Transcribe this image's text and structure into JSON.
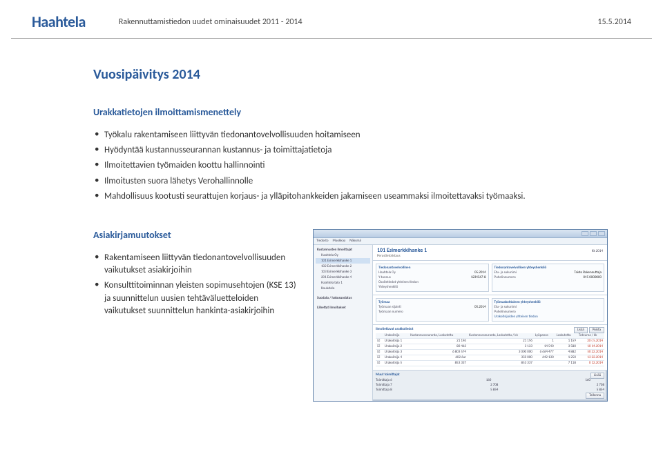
{
  "header": {
    "logo": "Haahtela",
    "title": "Rakennuttamistiedon uudet ominaisuudet 2011 - 2014",
    "date": "15.5.2014"
  },
  "main_heading": "Vuosipäivitys 2014",
  "section_declare": {
    "heading": "Urakkatietojen ilmoittamismenettely",
    "items": [
      "Työkalu rakentamiseen liittyvän tiedonantovelvollisuuden hoitamiseen",
      "Hyödyntää kustannusseurannan kustannus- ja toimittajatietoja",
      "Ilmoitettavien työmaiden koottu hallinnointi",
      "Ilmoitusten suora lähetys Verohallinnolle",
      "Mahdollisuus kootusti seurattujen korjaus- ja ylläpitohankkeiden jakamiseen useammaksi ilmoitettavaksi työmaaksi."
    ]
  },
  "section_docs": {
    "heading": "Asiakirjamuutokset",
    "items": [
      "Rakentamiseen liittyvän tiedonantovelvollisuuden vaikutukset asiakirjoihin",
      "Konsulttitoiminnan yleisten sopimusehtojen (KSE 13) ja suunnittelun uusien tehtäväluetteloiden vaikutukset suunnittelun hankinta-asiakirjoihin"
    ]
  },
  "screenshot": {
    "menu": [
      "Tiedosto",
      "Muokkaa",
      "Näkymä"
    ],
    "sidebar": {
      "root": "Kustannusten ilmoittajat",
      "items": [
        "Haahtela Oy",
        "101 Esimerkkihanke 1",
        "102 Esimerkkihanke 2",
        "103 Esimerkkihanke 3",
        "201 Esimerkkihanke 4",
        "Haahtela talo 1",
        "Koulutalo"
      ],
      "leaf1": "Suodata / hakusuodatus",
      "bottom": "Lähettyt ilmoitukset"
    },
    "project": {
      "title": "101 Esimerkkihanke 1",
      "subtitle": "Perustietolistaus",
      "year_label": "Kk",
      "year_val": "2014"
    },
    "panel_pt": {
      "title": "Tiedonantovelvollinen",
      "fields": [
        [
          "Haahtela Oy",
          ""
        ],
        [
          "Y-tunnus",
          "1234567-8"
        ],
        [
          "Osoitetiedot yhteisen tiedon",
          ""
        ],
        [
          "Yhteyshenkilö",
          ""
        ]
      ],
      "date": "05.2014"
    },
    "panel_yt": {
      "title": "Tiedonantovelvollisen yhteyshenkilö",
      "fields": [
        [
          "Etu- ja sukunimi",
          "Taisto   Rakennuttaja"
        ],
        [
          "Puhelinnumero",
          "045 0000000"
        ]
      ]
    },
    "panel_tm": {
      "title": "Työmaa",
      "date": "05.2014",
      "fields": [
        [
          "Työmaan sijainti",
          ""
        ],
        [
          "Työmaan numero",
          ""
        ]
      ]
    },
    "panel_tmy": {
      "title": "Työmaakohtainen yhteyshenkilö",
      "fields": [
        [
          "Etu- ja sukunimi",
          ""
        ],
        [
          "Puhelinnumero",
          ""
        ]
      ],
      "link": "Urakoitsijoiden yhteisen tiedon"
    },
    "table_urak": {
      "title": "Ilmoitettavat urakkatiedot",
      "headers": [
        "",
        "Urakoitsija",
        "Kustannusseuranta, Laskutettu",
        "Kustannusseuranta, Laskutettu / kk",
        "Lyöpanos",
        "Laskutettu",
        "Toteuma / kk"
      ],
      "rows": [
        [
          "☑",
          "Urakoitsija 1",
          "21 196",
          "21 196",
          "1",
          "1 159",
          "20 ( 5.2014",
          ""
        ],
        [
          "☑",
          "Urakoitsija 2",
          "80 463",
          "3 133",
          "14 540",
          "3 580",
          "10 14.2014",
          ""
        ],
        [
          "☑",
          "Urakoitsija 3",
          "6 803 574",
          "3 000 000",
          "6 664 477",
          "4 882",
          "50 22.2014",
          ""
        ],
        [
          "☑",
          "Urakoitsija 4",
          "602 êur",
          "350 000",
          "642 130",
          "1 250",
          "13 22.2014",
          ""
        ],
        [
          "☑",
          "Urakoitsija 5",
          "853 337",
          "853 337",
          "",
          "7 118",
          "0 12.2014",
          ""
        ]
      ],
      "buttons": [
        "Lisää",
        "Poista"
      ]
    },
    "muut": {
      "title": "Muut toimittajat",
      "rows": [
        [
          "Toimittaja 6",
          "160",
          "160"
        ],
        [
          "Toimittaja 7",
          "2 708",
          "2 708"
        ],
        [
          "Toimittaja 8",
          "5 854",
          "5 854"
        ]
      ],
      "buttons": [
        "Lisää"
      ],
      "footer_btn": "Tallenna"
    }
  }
}
